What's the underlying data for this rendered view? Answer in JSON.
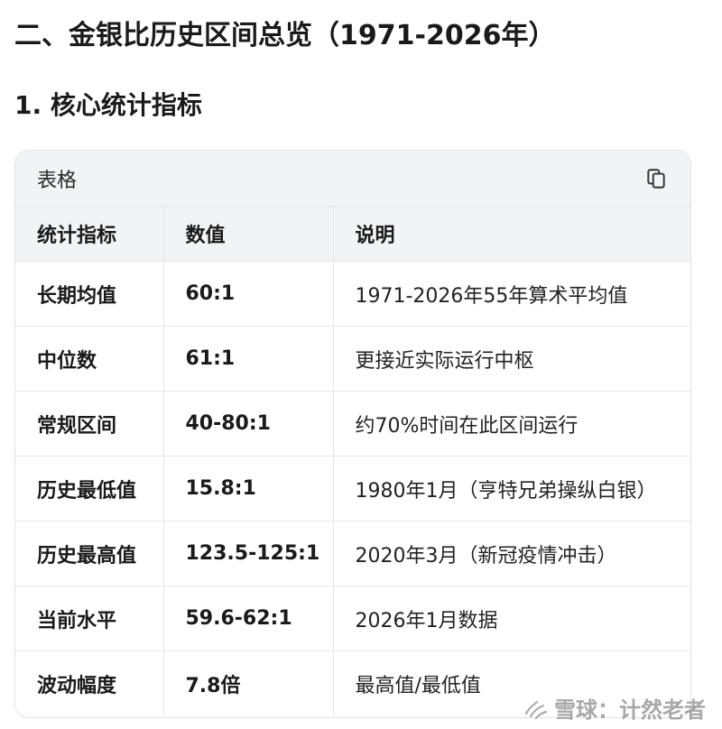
{
  "heading": {
    "section_title": "二、金银比历史区间总览（1971-2026年）",
    "subsection_title": "1. 核心统计指标"
  },
  "table_card": {
    "label": "表格",
    "copy_icon": "copy-icon",
    "columns": [
      "统计指标",
      "数值",
      "说明"
    ],
    "rows": [
      {
        "name": "长期均值",
        "value": "60:1",
        "desc": "1971-2026年55年算术平均值"
      },
      {
        "name": "中位数",
        "value": "61:1",
        "desc": "更接近实际运行中枢"
      },
      {
        "name": "常规区间",
        "value": "40-80:1",
        "desc": "约70%时间在此区间运行"
      },
      {
        "name": "历史最低值",
        "value": "15.8:1",
        "desc": "1980年1月（亨特兄弟操纵白银）"
      },
      {
        "name": "历史最高值",
        "value": "123.5-125:1",
        "desc": "2020年3月（新冠疫情冲击）"
      },
      {
        "name": "当前水平",
        "value": "59.6-62:1",
        "desc": "2026年1月数据"
      },
      {
        "name": "波动幅度",
        "value": "7.8倍",
        "desc": "最高值/最低值"
      }
    ]
  },
  "watermark": {
    "text": "雪球：计然老者",
    "icon": "snowball-logo-icon"
  }
}
